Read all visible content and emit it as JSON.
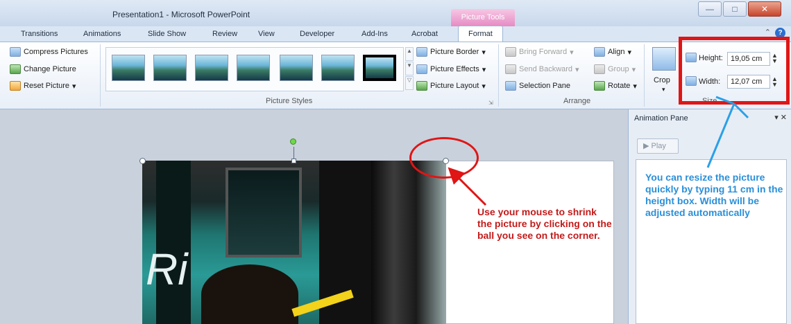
{
  "window": {
    "title": "Presentation1 - Microsoft PowerPoint",
    "contextual_tab_header": "Picture Tools"
  },
  "tabs": [
    {
      "label": "Transitions"
    },
    {
      "label": "Animations"
    },
    {
      "label": "Slide Show"
    },
    {
      "label": "Review"
    },
    {
      "label": "View"
    },
    {
      "label": "Developer"
    },
    {
      "label": "Add-Ins"
    },
    {
      "label": "Acrobat"
    },
    {
      "label": "Format"
    }
  ],
  "active_tab": "Format",
  "ribbon": {
    "adjust": {
      "compress": "Compress Pictures",
      "change": "Change Picture",
      "reset": "Reset Picture"
    },
    "picture_styles": {
      "label": "Picture Styles",
      "border": "Picture Border",
      "effects": "Picture Effects",
      "layout": "Picture Layout"
    },
    "arrange": {
      "label": "Arrange",
      "bring_forward": "Bring Forward",
      "send_backward": "Send Backward",
      "selection_pane": "Selection Pane",
      "align": "Align",
      "group": "Group",
      "rotate": "Rotate"
    },
    "size": {
      "label": "Size",
      "crop": "Crop",
      "height_label": "Height:",
      "height_value": "19,05 cm",
      "width_label": "Width:",
      "width_value": "12,07 cm"
    }
  },
  "annotations": {
    "red": "Use your mouse to shrink the picture by clicking on the ball you see on the corner.",
    "blue": "You can resize the picture quickly by typing 11 cm in the height box. Width will be adjusted automatically"
  },
  "animation_pane": {
    "title": "Animation Pane",
    "play": "Play"
  },
  "colors": {
    "annotation_red": "#c41a1a",
    "annotation_blue": "#2a8fd8",
    "highlight_red": "#e01515",
    "contextual_pink": "#e58bc4"
  }
}
